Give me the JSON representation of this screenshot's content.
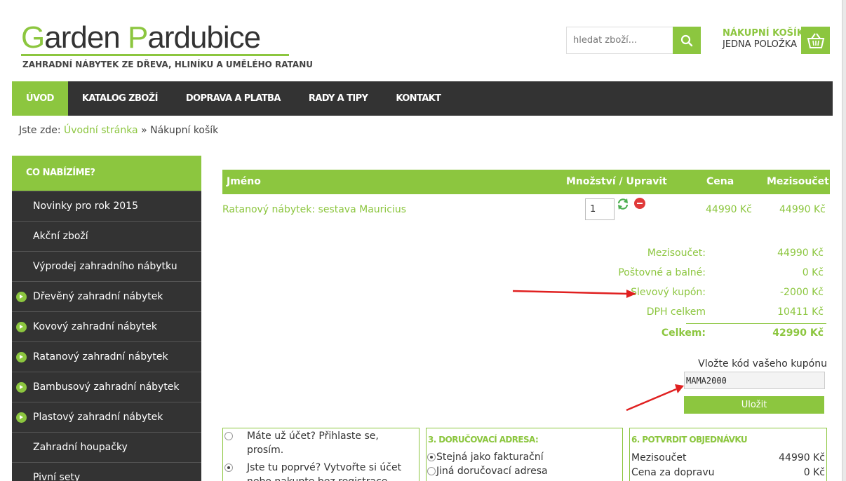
{
  "header": {
    "logo_first": "G",
    "logo_rest1": "arden ",
    "logo_second": "P",
    "logo_rest2": "ardubice",
    "tagline": "ZAHRADNÍ NÁBYTEK ZE DŘEVA, HLINÍKU A UMĚLÉHO RATANU",
    "search_placeholder": "hledat zboží...",
    "cart_title": "NÁKUPNÍ KOŠÍK",
    "cart_count": "JEDNA POLOŽKA"
  },
  "nav": {
    "items": [
      "ÚVOD",
      "KATALOG ZBOŽÍ",
      "DOPRAVA A PLATBA",
      "RADY A TIPY",
      "KONTAKT"
    ],
    "active": "ÚVOD"
  },
  "breadcrumb": {
    "prefix": "Jste zde:",
    "home": "Úvodní stránka",
    "separator": "»",
    "current": "Nákupní košík"
  },
  "sidebar": {
    "heading": "CO NABÍZÍME?",
    "items": [
      "Novinky pro rok 2015",
      "Akční zboží",
      "Výprodej zahradního nábytku",
      "Dřevěný zahradní nábytek",
      "Kovový zahradní nábytek",
      "Ratanový zahradní nábytek",
      "Bambusový zahradní nábytek",
      "Plastový zahradní nábytek",
      "Zahradní houpačky",
      "Pivní sety"
    ]
  },
  "cart": {
    "columns": {
      "name": "Jméno",
      "qty": "Množství / Upravit",
      "price": "Cena",
      "subtotal": "Mezisoučet"
    },
    "row": {
      "name": "Ratanový nábytek: sestava Mauricius",
      "qty": "1",
      "price": "44990 Kč",
      "subtotal": "44990 Kč"
    },
    "summary": {
      "subtotal_label": "Mezisoučet:",
      "subtotal_value": "44990 Kč",
      "shipping_label": "Poštovné a balné:",
      "shipping_value": "0 Kč",
      "coupon_label": "Slevový kupón:",
      "coupon_value": "-2000 Kč",
      "vat_label": "DPH celkem",
      "vat_value": "10411 Kč",
      "total_label": "Celkem:",
      "total_value": "42990 Kč"
    },
    "coupon": {
      "label": "Vložte kód vašeho kupónu",
      "value": "MAMA2000",
      "save_label": "Uložit"
    }
  },
  "account_panel": {
    "login_option": "Máte už účet? Přihlaste se, prosím.",
    "new_option": "Jste tu poprvé? Vytvořte si účet nebo nakupte bez registrace."
  },
  "address_panel": {
    "title": "3. DORUČOVACÍ ADRESA:",
    "same_option": "Stejná jako fakturační",
    "other_option": "Jiná doručovací adresa"
  },
  "confirm_panel": {
    "title": "6. POTVRDIT OBJEDNÁVKU",
    "subtotal_label": "Mezisoučet",
    "subtotal_value": "44990 Kč",
    "shipping_label": "Cena za dopravu",
    "shipping_value": "0 Kč"
  },
  "colors": {
    "accent": "#8cc63f",
    "dark": "#333333",
    "annotation": "#e02020"
  }
}
